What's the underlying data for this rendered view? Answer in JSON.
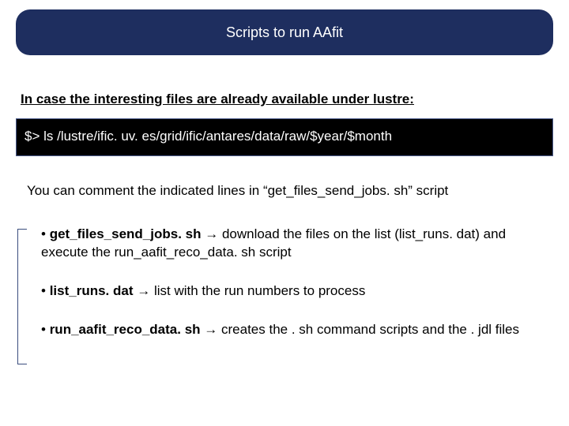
{
  "header": {
    "title": "Scripts to run AAfit"
  },
  "intro": "In case the interesting files are already available under lustre:",
  "command": "$> ls /lustre/ific. uv. es/grid/ific/antares/data/raw/$year/$month",
  "note": "You can comment the indicated lines in “get_files_send_jobs. sh” script",
  "bullets": [
    {
      "name": "get_files_send_jobs. sh",
      "arrow": " → ",
      "desc": "download the files on the list (list_runs. dat) and execute the run_aafit_reco_data. sh script"
    },
    {
      "name": "list_runs. dat",
      "arrow": " → ",
      "desc": "list with the run numbers to process"
    },
    {
      "name": "run_aafit_reco_data. sh",
      "arrow": "  → ",
      "desc": "creates the . sh command scripts and the . jdl files"
    }
  ]
}
